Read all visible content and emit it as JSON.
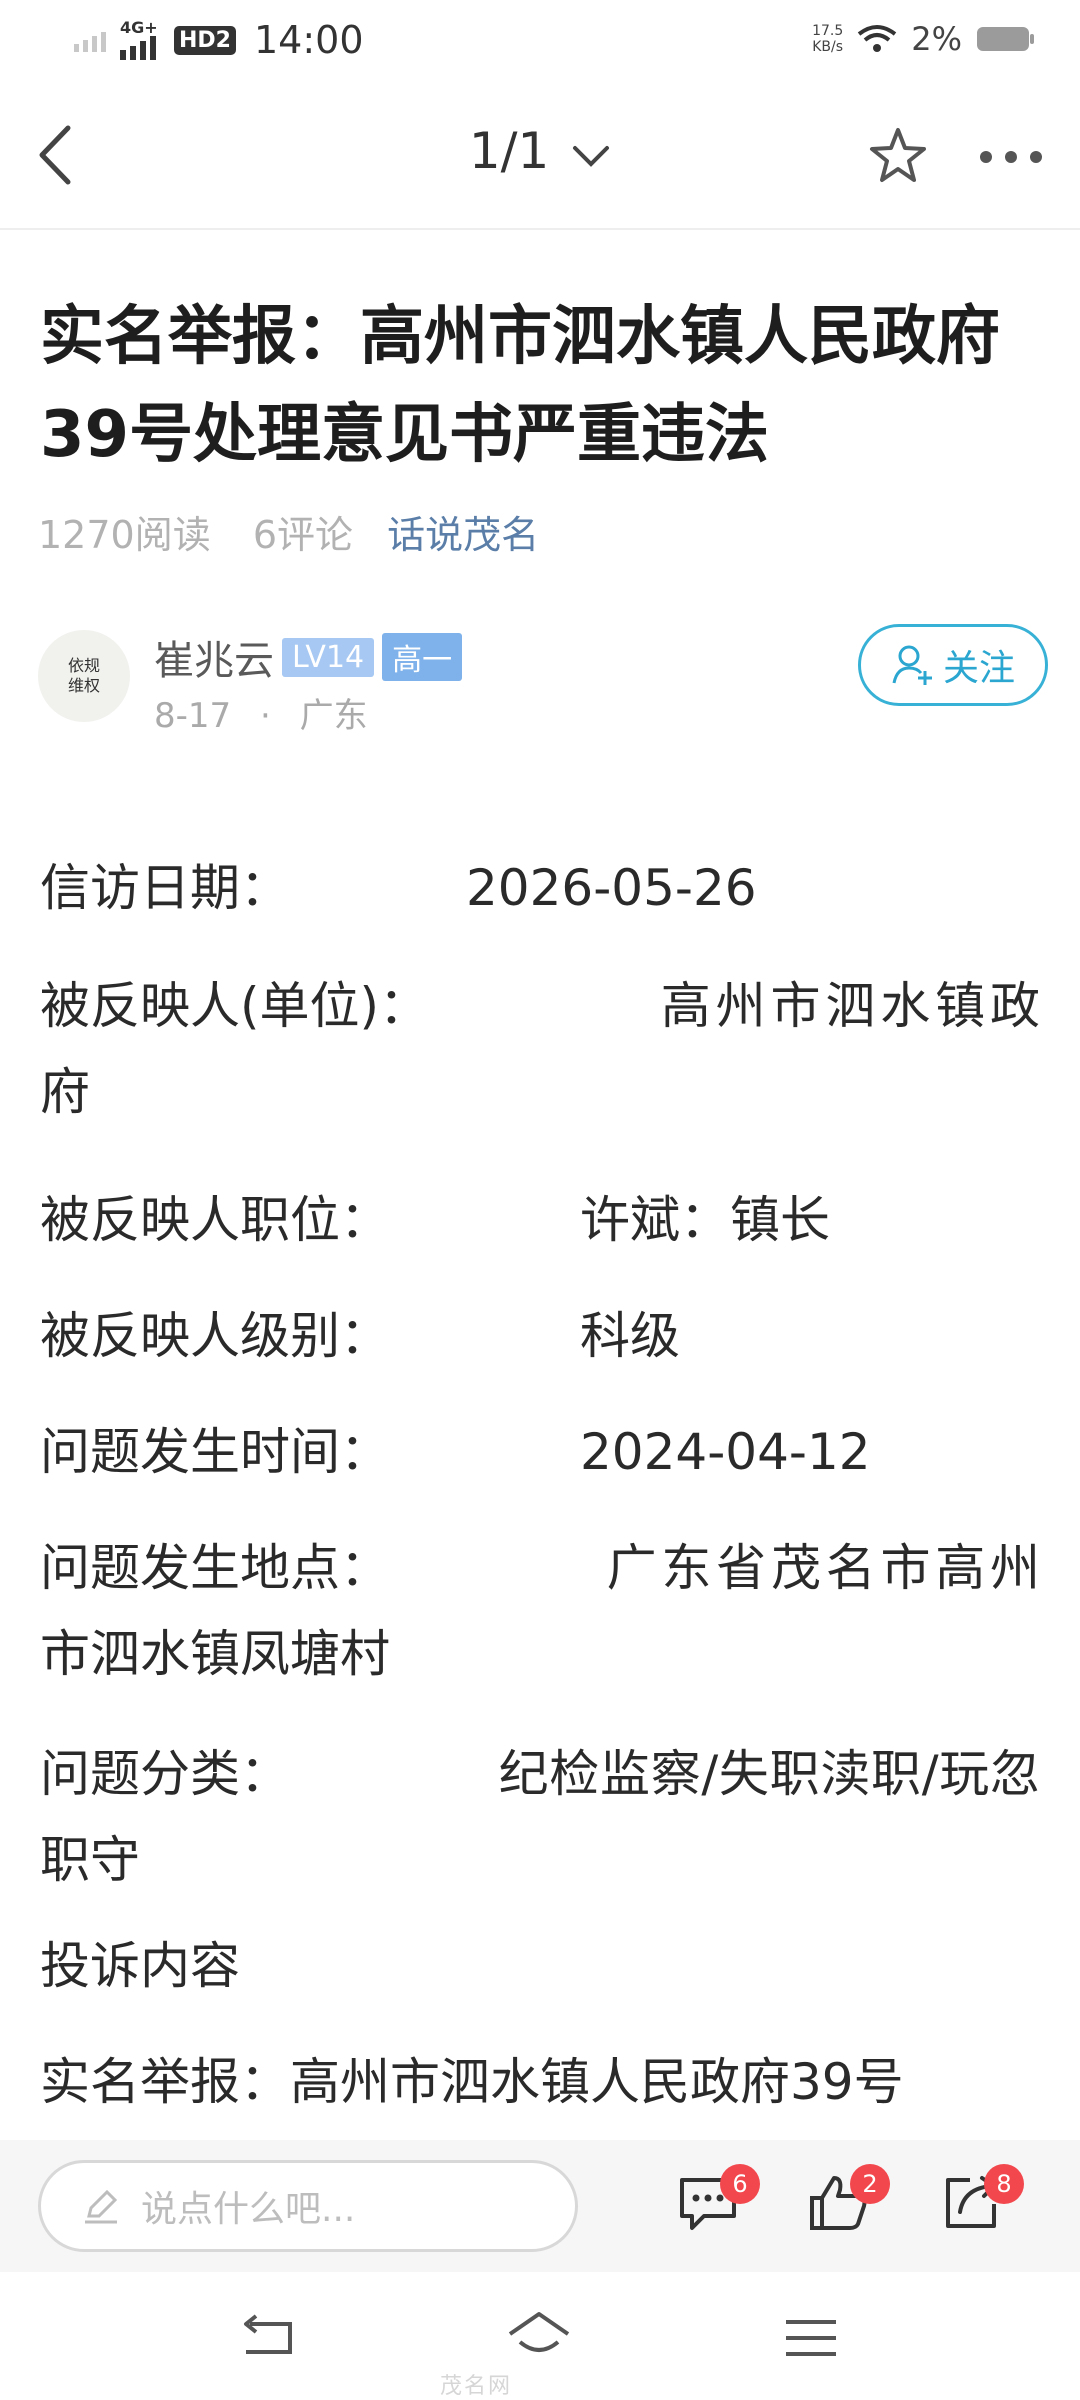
{
  "status": {
    "network": "4G+",
    "hd": "HD2",
    "time": "14:00",
    "speed_value": "17.5",
    "speed_unit": "KB/s",
    "battery": "2%"
  },
  "header": {
    "pager": "1/1"
  },
  "article": {
    "title": "实名举报：高州市泗水镇人民政府39号处理意见书严重违法",
    "reads": "1270阅读",
    "comments": "6评论",
    "category": "话说茂名"
  },
  "author": {
    "avatar_text": "依规维权",
    "name": "崔兆云",
    "level": "LV14",
    "grade": "高一",
    "date": "8-17",
    "sep": "·",
    "location": "广东",
    "follow_label": "关注"
  },
  "content": {
    "date_label": "信访日期：",
    "date_value": "2026-05-26",
    "unit_label": "被反映人(单位)：",
    "unit_value": "高州市泗水镇政府",
    "position_label": "被反映人职位：",
    "position_value": "许斌：镇长",
    "rank_label": "被反映人级别：",
    "rank_value": "科级",
    "time_label": "问题发生时间：",
    "time_value": "2024-04-12",
    "place_label": "问题发生地点：",
    "place_value": "广东省茂名市高州市泗水镇凤塘村",
    "category_label": "问题分类：",
    "category_value": "纪检监察/失职渎职/玩忽职守",
    "complaint_heading": "投诉内容",
    "complaint_first_line": "实名举报：高州市泗水镇人民政府39号"
  },
  "comment_bar": {
    "placeholder": "说点什么吧...",
    "comment_count": "6",
    "like_count": "2",
    "share_count": "8"
  },
  "watermark": "茂名网"
}
